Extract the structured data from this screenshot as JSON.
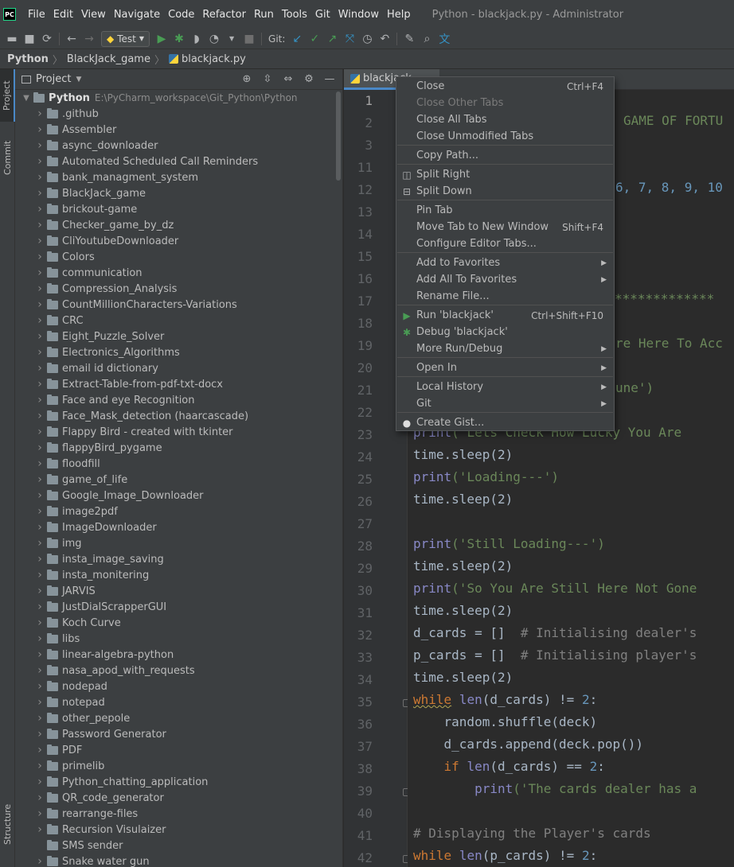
{
  "menubar": {
    "logo": "PC",
    "items": [
      "File",
      "Edit",
      "View",
      "Navigate",
      "Code",
      "Refactor",
      "Run",
      "Tools",
      "Git",
      "Window",
      "Help"
    ],
    "window_title": "Python - blackjack.py - Administrator"
  },
  "toolbar": {
    "run_config": "Test",
    "git_label": "Git:",
    "icons": [
      "folder-open-icon",
      "save-icon",
      "sync-icon",
      "back-arrow-icon",
      "forward-arrow-icon",
      "run-icon",
      "debug-icon",
      "coverage-icon",
      "profile-icon",
      "stop-icon",
      "git-update-icon",
      "git-commit-icon",
      "git-push-icon",
      "git-merge-icon",
      "history-icon",
      "rollback-icon",
      "wrench-icon",
      "search-icon",
      "translate-icon"
    ]
  },
  "breadcrumb": [
    "Python",
    "BlackJack_game",
    "blackjack.py"
  ],
  "sidebar_tabs": {
    "project": "Project",
    "commit": "Commit",
    "structure": "Structure"
  },
  "project": {
    "title": "Project",
    "root_name": "Python",
    "root_path": "E:\\PyCharm_workspace\\Git_Python\\Python",
    "folders": [
      ".github",
      "Assembler",
      "async_downloader",
      "Automated Scheduled Call Reminders",
      "bank_managment_system",
      "BlackJack_game",
      "brickout-game",
      "Checker_game_by_dz",
      "CliYoutubeDownloader",
      "Colors",
      "communication",
      "Compression_Analysis",
      "CountMillionCharacters-Variations",
      "CRC",
      "Eight_Puzzle_Solver",
      "Electronics_Algorithms",
      "email id dictionary",
      "Extract-Table-from-pdf-txt-docx",
      "Face and eye Recognition",
      "Face_Mask_detection (haarcascade)",
      "Flappy Bird - created with tkinter",
      "flappyBird_pygame",
      "floodfill",
      "game_of_life",
      "Google_Image_Downloader",
      "image2pdf",
      "ImageDownloader",
      "img",
      "insta_image_saving",
      "insta_monitering",
      "JARVIS",
      "JustDialScrapperGUI",
      "Koch Curve",
      "libs",
      "linear-algebra-python",
      "nasa_apod_with_requests",
      "nodepad",
      "notepad",
      "other_pepole",
      "Password Generator",
      "PDF",
      "primelib",
      "Python_chatting_application",
      "QR_code_generator",
      "rearrange-files",
      "Recursion Visulaizer",
      "SMS sender",
      "Snake water gun"
    ]
  },
  "editor": {
    "tab_label": "blackjack",
    "line_numbers": [
      "1",
      "2",
      "3",
      "11",
      "12",
      "13",
      "14",
      "15",
      "16",
      "17",
      "18",
      "19",
      "20",
      "21",
      "22",
      "23",
      "24",
      "25",
      "26",
      "27",
      "28",
      "29",
      "30",
      "31",
      "32",
      "33",
      "34",
      "35",
      "36",
      "37",
      "38",
      "39",
      "40",
      "41",
      "42"
    ],
    "code_frag": {
      "l2": "GAME OF FORTU",
      "l12": "6, 7, 8, 9, 10",
      "l17": "*************",
      "l19": "re Here To Acc",
      "l21": "une')",
      "l23a": "print",
      "l23b": "('Lets Check How Lucky You Are",
      "sleep": "time.sleep(2)",
      "l25a": "print",
      "l25b": "('Loading---')",
      "l28a": "print",
      "l28b": "('Still Loading---')",
      "l30a": "print",
      "l30b": "('So You Are Still Here Not Gone",
      "l32a": "d_cards = []  ",
      "l32b": "# Initialising dealer's",
      "l33a": "p_cards = []  ",
      "l33b": "# Initialising player's",
      "l35a": "while",
      "l35b": "len",
      "l35c": "(d_cards) != ",
      "l35d": "2",
      "l35e": ":",
      "l36": "    random.shuffle(deck)",
      "l37": "    d_cards.append(deck.pop())",
      "l38a": "    if ",
      "l38b": "len",
      "l38c": "(d_cards) == ",
      "l38d": "2",
      "l38e": ":",
      "l39a": "        print",
      "l39b": "('The cards dealer has a",
      "l41": "# Displaying the Player's cards",
      "l42a": "while",
      "l42b": "len",
      "l42c": "(p_cards) != ",
      "l42d": "2",
      "l42e": ":"
    }
  },
  "context_menu": {
    "items": [
      {
        "label": "Close",
        "shortcut": "Ctrl+F4"
      },
      {
        "label": "Close Other Tabs",
        "disabled": true
      },
      {
        "label": "Close All Tabs"
      },
      {
        "label": "Close Unmodified Tabs"
      },
      {
        "label": "Copy Path..."
      },
      {
        "label": "Split Right",
        "icon": "split-right-icon"
      },
      {
        "label": "Split Down",
        "icon": "split-down-icon"
      },
      {
        "label": "Pin Tab"
      },
      {
        "label": "Move Tab to New Window",
        "shortcut": "Shift+F4"
      },
      {
        "label": "Configure Editor Tabs..."
      },
      {
        "label": "Add to Favorites",
        "submenu": true
      },
      {
        "label": "Add All To Favorites",
        "submenu": true
      },
      {
        "label": "Rename File..."
      },
      {
        "label": "Run 'blackjack'",
        "shortcut": "Ctrl+Shift+F10",
        "icon": "run-icon"
      },
      {
        "label": "Debug 'blackjack'",
        "icon": "debug-icon"
      },
      {
        "label": "More Run/Debug",
        "submenu": true
      },
      {
        "label": "Open In",
        "submenu": true
      },
      {
        "label": "Local History",
        "submenu": true
      },
      {
        "label": "Git",
        "submenu": true
      },
      {
        "label": "Create Gist...",
        "icon": "github-icon"
      }
    ]
  },
  "colors": {
    "background": "#2b2b2b",
    "panel": "#3c3f41",
    "accent": "#4a88c7",
    "run_green": "#499c54"
  }
}
